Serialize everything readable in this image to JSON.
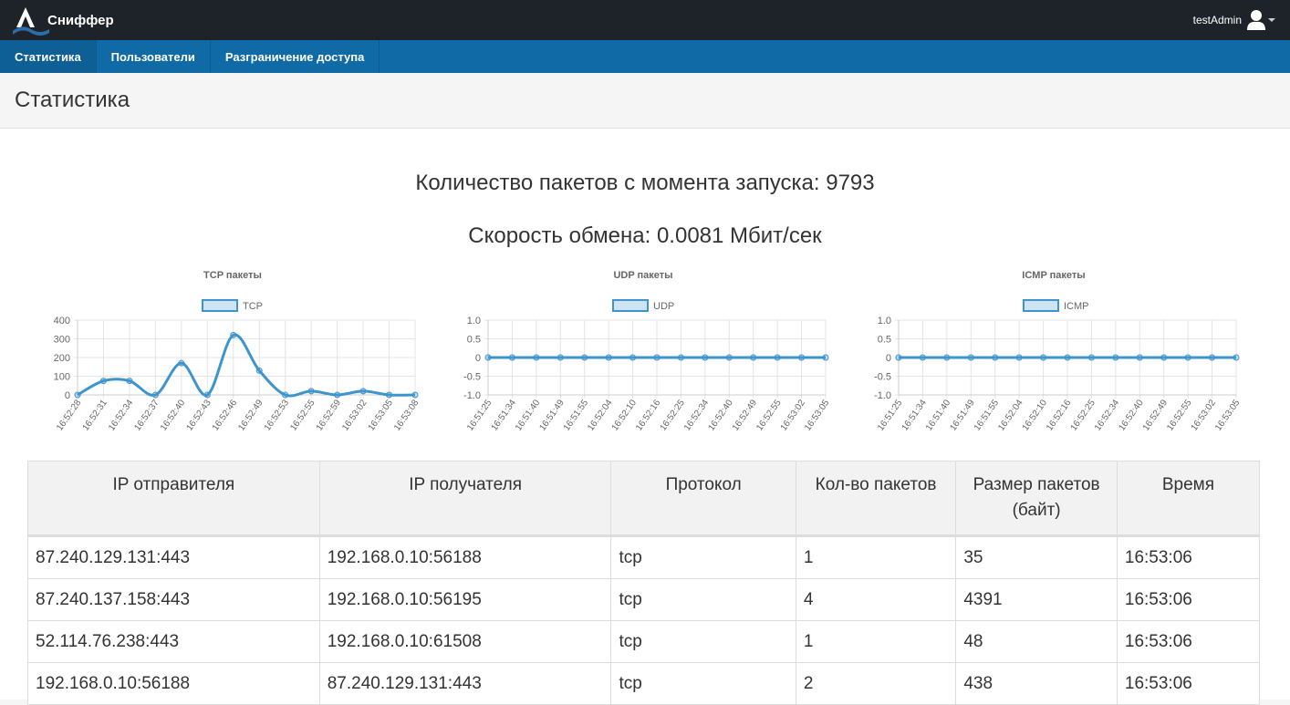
{
  "app": {
    "brand": "Сниффер",
    "user": "testAdmin"
  },
  "nav": {
    "items": [
      {
        "label": "Статистика"
      },
      {
        "label": "Пользователи"
      },
      {
        "label": "Разграничение доступа"
      }
    ]
  },
  "page": {
    "title": "Статистика"
  },
  "stats": {
    "packets_text": "Количество пакетов с момента запуска: 9793",
    "speed_text": "Скорость обмена: 0.0081 Мбит/сек"
  },
  "colors": {
    "topbar": "#1e2329",
    "nav": "#0f6aa6",
    "line": "#3e95cd"
  },
  "chart_data": [
    {
      "type": "line",
      "title": "TCP пакеты",
      "legend": "TCP",
      "x": [
        "16:52:28",
        "16:52:31",
        "16:52:34",
        "16:52:37",
        "16:52:40",
        "16:52:43",
        "16:52:46",
        "16:52:49",
        "16:52:53",
        "16:52:55",
        "16:52:59",
        "16:53:02",
        "16:53:05",
        "16:53:08"
      ],
      "values": [
        0,
        75,
        75,
        0,
        170,
        0,
        320,
        130,
        0,
        20,
        0,
        20,
        0,
        0
      ],
      "ylim": [
        0,
        400
      ],
      "yticks": [
        0,
        100,
        200,
        300,
        400
      ],
      "grid": true,
      "legend_position": "top"
    },
    {
      "type": "line",
      "title": "UDP пакеты",
      "legend": "UDP",
      "x": [
        "16:51:25",
        "16:51:34",
        "16:51:40",
        "16:51:49",
        "16:51:55",
        "16:52:04",
        "16:52:10",
        "16:52:16",
        "16:52:25",
        "16:52:34",
        "16:52:40",
        "16:52:49",
        "16:52:55",
        "16:53:02",
        "16:53:05"
      ],
      "values": [
        0,
        0,
        0,
        0,
        0,
        0,
        0,
        0,
        0,
        0,
        0,
        0,
        0,
        0,
        0
      ],
      "ylim": [
        -1.0,
        1.0
      ],
      "yticks": [
        "1.0",
        "0.5",
        "0",
        "-0.5",
        "-1.0"
      ],
      "grid": true,
      "legend_position": "top"
    },
    {
      "type": "line",
      "title": "ICMP пакеты",
      "legend": "ICMP",
      "x": [
        "16:51:25",
        "16:51:34",
        "16:51:40",
        "16:51:49",
        "16:51:55",
        "16:52:04",
        "16:52:10",
        "16:52:16",
        "16:52:25",
        "16:52:34",
        "16:52:40",
        "16:52:49",
        "16:52:55",
        "16:53:02",
        "16:53:05"
      ],
      "values": [
        0,
        0,
        0,
        0,
        0,
        0,
        0,
        0,
        0,
        0,
        0,
        0,
        0,
        0,
        0
      ],
      "ylim": [
        -1.0,
        1.0
      ],
      "yticks": [
        "1.0",
        "0.5",
        "0",
        "-0.5",
        "-1.0"
      ],
      "grid": true,
      "legend_position": "top"
    }
  ],
  "table": {
    "headers": [
      "IP отправителя",
      "IP получателя",
      "Протокол",
      "Кол-во пакетов",
      "Размер пакетов (байт)",
      "Время"
    ],
    "rows": [
      [
        "87.240.129.131:443",
        "192.168.0.10:56188",
        "tcp",
        "1",
        "35",
        "16:53:06"
      ],
      [
        "87.240.137.158:443",
        "192.168.0.10:56195",
        "tcp",
        "4",
        "4391",
        "16:53:06"
      ],
      [
        "52.114.76.238:443",
        "192.168.0.10:61508",
        "tcp",
        "1",
        "48",
        "16:53:06"
      ],
      [
        "192.168.0.10:56188",
        "87.240.129.131:443",
        "tcp",
        "2",
        "438",
        "16:53:06"
      ]
    ]
  }
}
